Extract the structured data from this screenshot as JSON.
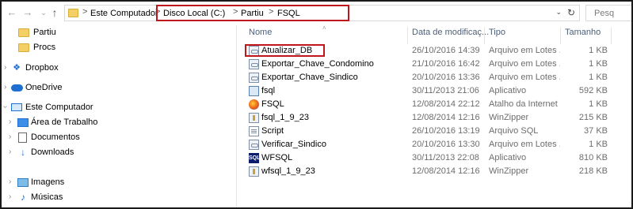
{
  "address_bar": {
    "crumbs": [
      "Este Computador",
      "Disco Local (C:)",
      "Partiu",
      "FSQL"
    ],
    "separator": ">"
  },
  "search": {
    "placeholder": "Pesq"
  },
  "sidebar": {
    "items": [
      {
        "label": "Partiu",
        "icon": "folder-icon"
      },
      {
        "label": "Procs",
        "icon": "folder-icon"
      },
      {
        "label": "Dropbox",
        "icon": "dropbox-icon"
      },
      {
        "label": "OneDrive",
        "icon": "onedrive-icon"
      },
      {
        "label": "Este Computador",
        "icon": "computer-icon"
      },
      {
        "label": "Área de Trabalho",
        "icon": "desktop-icon"
      },
      {
        "label": "Documentos",
        "icon": "documents-icon"
      },
      {
        "label": "Downloads",
        "icon": "downloads-icon"
      },
      {
        "label": "Imagens",
        "icon": "pictures-icon"
      },
      {
        "label": "Músicas",
        "icon": "music-icon"
      }
    ]
  },
  "columns": {
    "name": "Nome",
    "date": "Data de modificaç...",
    "type": "Tipo",
    "size": "Tamanho"
  },
  "files": [
    {
      "name": "Atualizar_DB",
      "date": "26/10/2016 14:39",
      "type": "Arquivo em Lotes ...",
      "size": "1 KB",
      "icon": "batch-file-icon",
      "highlighted": true
    },
    {
      "name": "Exportar_Chave_Condomino",
      "date": "21/10/2016 16:42",
      "type": "Arquivo em Lotes ...",
      "size": "1 KB",
      "icon": "batch-file-icon"
    },
    {
      "name": "Exportar_Chave_Sindico",
      "date": "20/10/2016 13:36",
      "type": "Arquivo em Lotes ...",
      "size": "1 KB",
      "icon": "batch-file-icon"
    },
    {
      "name": "fsql",
      "date": "30/11/2013 21:06",
      "type": "Aplicativo",
      "size": "592 KB",
      "icon": "application-icon"
    },
    {
      "name": "FSQL",
      "date": "12/08/2014 22:12",
      "type": "Atalho da Internet",
      "size": "1 KB",
      "icon": "internet-shortcut-icon"
    },
    {
      "name": "fsql_1_9_23",
      "date": "12/08/2014 12:16",
      "type": "WinZipper",
      "size": "215 KB",
      "icon": "zip-file-icon"
    },
    {
      "name": "Script",
      "date": "26/10/2016 13:19",
      "type": "Arquivo SQL",
      "size": "37 KB",
      "icon": "sql-file-icon"
    },
    {
      "name": "Verificar_Sindico",
      "date": "20/10/2016 13:30",
      "type": "Arquivo em Lotes ...",
      "size": "1 KB",
      "icon": "batch-file-icon"
    },
    {
      "name": "WFSQL",
      "date": "30/11/2013 22:08",
      "type": "Aplicativo",
      "size": "810 KB",
      "icon": "wfsql-app-icon"
    },
    {
      "name": "wfsql_1_9_23",
      "date": "12/08/2014 12:16",
      "type": "WinZipper",
      "size": "218 KB",
      "icon": "zip-file-icon"
    }
  ],
  "icons": {
    "wfsql_badge": "SQL"
  },
  "colors": {
    "highlight_border": "#c0161b",
    "header_text": "#4c607a",
    "accent_blue": "#1f6fd1"
  }
}
